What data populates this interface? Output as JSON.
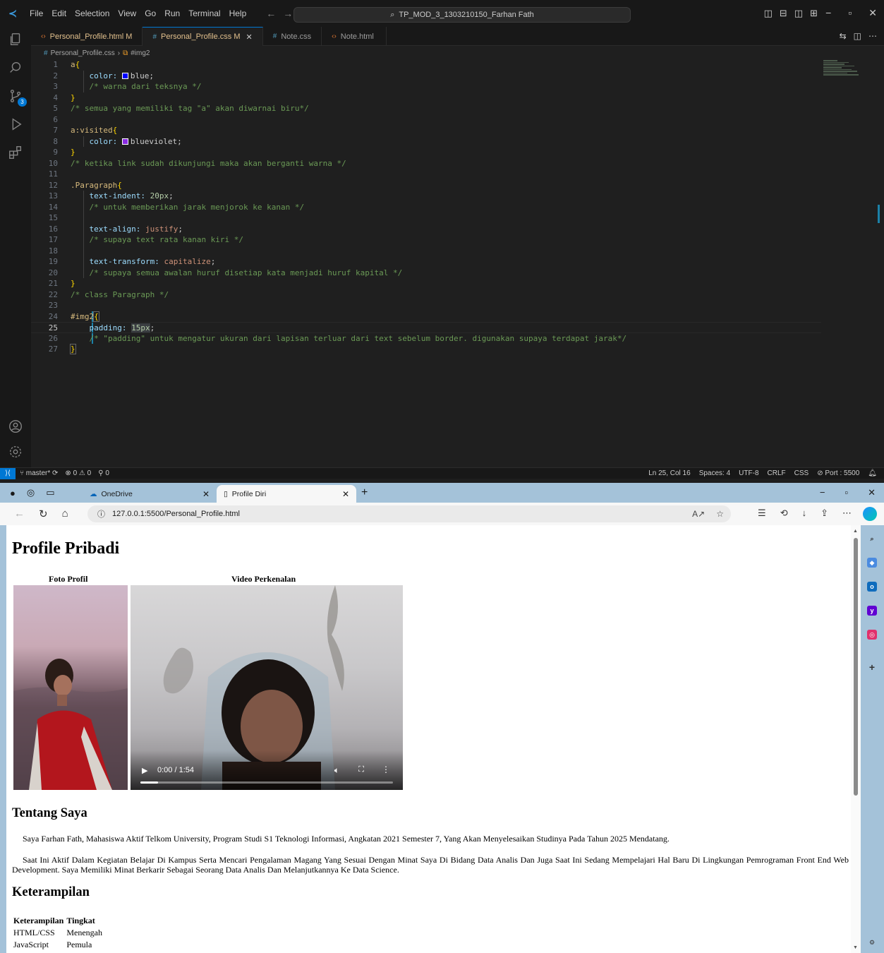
{
  "vscode": {
    "menu": [
      "File",
      "Edit",
      "Selection",
      "View",
      "Go",
      "Run",
      "Terminal",
      "Help"
    ],
    "command_center": "TP_MOD_3_1303210150_Farhan Fath",
    "tabs": [
      {
        "label": "Personal_Profile.html",
        "suffix": "M",
        "type": "html"
      },
      {
        "label": "Personal_Profile.css",
        "suffix": "M",
        "type": "css",
        "active": true
      },
      {
        "label": "Note.css",
        "suffix": "",
        "type": "css"
      },
      {
        "label": "Note.html",
        "suffix": "",
        "type": "html"
      }
    ],
    "breadcrumb": {
      "file": "Personal_Profile.css",
      "symbol": "#img2"
    },
    "scm_badge": "3",
    "code": {
      "l2_prop": "color: ",
      "l2_val": "blue",
      "l2_color": "#0000ff",
      "l3": "/* warna dari teksnya */",
      "l5": "/* semua yang memiliki tag \"a\" akan diwarnai biru*/",
      "l7": "a:visited",
      "l8_prop": "color: ",
      "l8_val": "blueviolet",
      "l8_color": "#8a2be2",
      "l10": "/* ketika link sudah dikunjungi maka akan berganti warna */",
      "l12": ".Paragraph",
      "l13_prop": "text-indent: ",
      "l13_val": "20px",
      "l14": "/* untuk memberikan jarak menjorok ke kanan */",
      "l16_prop": "text-align: ",
      "l16_val": "justify",
      "l17": "/* supaya text rata kanan kiri */",
      "l19_prop": "text-transform: ",
      "l19_val": "capitalize",
      "l20": "/* supaya semua awalan huruf disetiap kata menjadi huruf kapital */",
      "l22": "/* class Paragraph */",
      "l24": "#img2",
      "l25_prop": "padding: ",
      "l25_val": "15px",
      "l26": "/* \"padding\" untuk mengatur ukuran dari lapisan terluar dari text sebelum border. digunakan supaya terdapat jarak*/"
    },
    "status": {
      "branch": "master*",
      "errors": "0",
      "warnings": "0",
      "ports": "0",
      "position": "Ln 25, Col 16",
      "spaces": "Spaces: 4",
      "encoding": "UTF-8",
      "eol": "CRLF",
      "language": "CSS",
      "port": "Port : 5500"
    }
  },
  "browser": {
    "tabs": [
      {
        "label": "OneDrive"
      },
      {
        "label": "Profile Diri"
      }
    ],
    "url": "127.0.0.1:5500/Personal_Profile.html",
    "page": {
      "title": "Profile Pribadi",
      "photo_header": "Foto Profil",
      "video_header": "Video Perkenalan",
      "video_time": "0:00 / 1:54",
      "video_progress": 0.07,
      "about_heading": "Tentang Saya",
      "about_p1": "Saya Farhan Fath, Mahasiswa Aktif Telkom University, Program Studi S1 Teknologi Informasi, Angkatan 2021 Semester 7, Yang Akan Menyelesaikan Studinya Pada Tahun 2025 Mendatang.",
      "about_p2": "Saat Ini Aktif Dalam Kegiatan Belajar Di Kampus Serta Mencari Pengalaman Magang Yang Sesuai Dengan Minat Saya Di Bidang Data Analis Dan Juga Saat Ini Sedang Mempelajari Hal Baru Di Lingkungan Pemrograman Front End Web Development. Saya Memiliki Minat Berkarir Sebagai Seorang Data Analis Dan Melanjutkannya Ke Data Science.",
      "skills_heading": "Keterampilan",
      "skills_columns": [
        "Keterampilan",
        "Tingkat"
      ],
      "skills_rows": [
        [
          "HTML/CSS",
          "Menengah"
        ],
        [
          "JavaScript",
          "Pemula"
        ]
      ]
    }
  },
  "colors": {
    "accent": "#0078d4",
    "edge_frame": "#a4c2d9"
  }
}
